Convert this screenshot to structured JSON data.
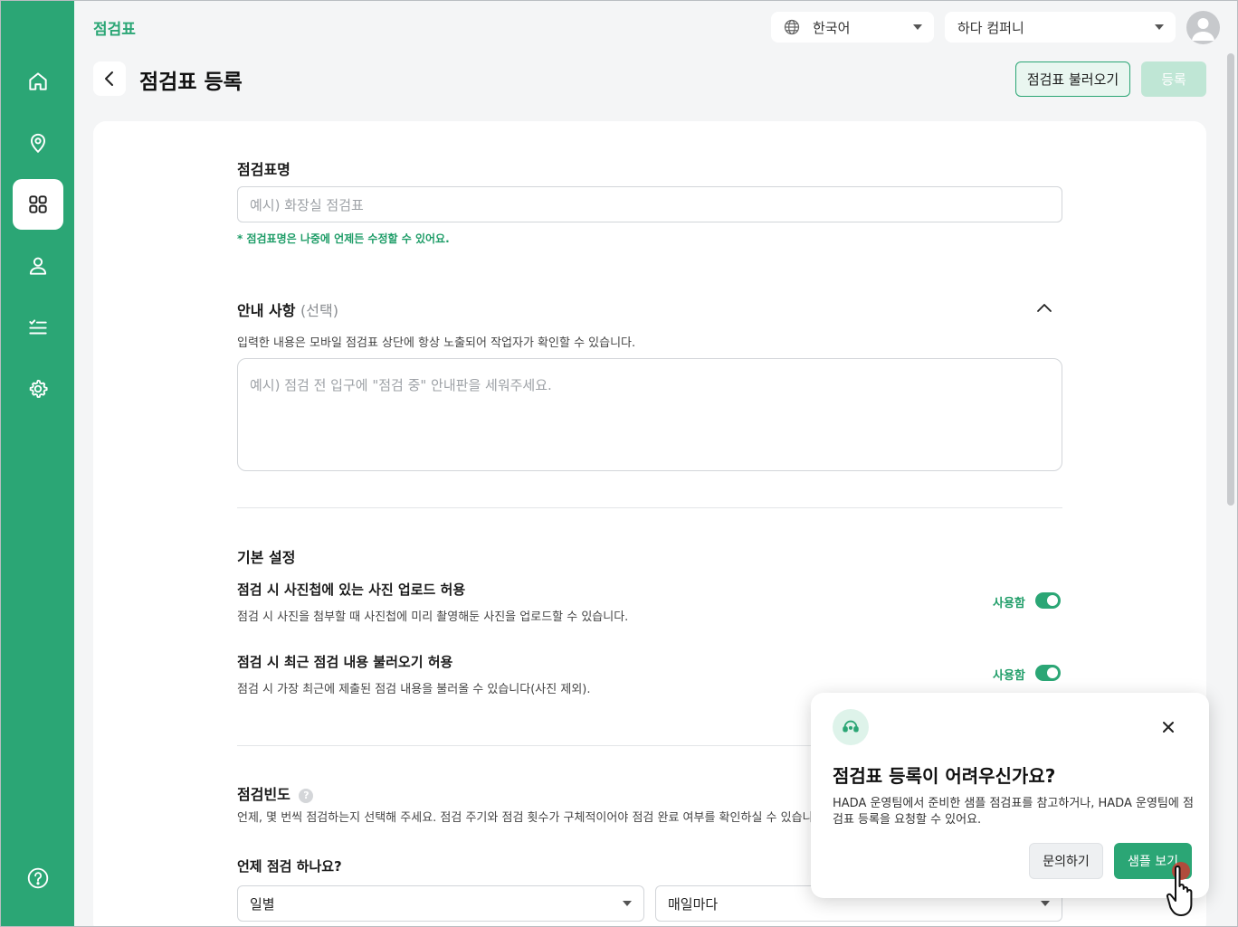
{
  "header": {
    "brand": "점검표",
    "language": "한국어",
    "company": "하다 컴퍼니"
  },
  "sidebar": {
    "items": [
      {
        "name": "home-icon"
      },
      {
        "name": "location-icon"
      },
      {
        "name": "grid-icon",
        "active": true
      },
      {
        "name": "user-icon"
      },
      {
        "name": "checklist-icon"
      },
      {
        "name": "gear-icon"
      }
    ],
    "help": "?"
  },
  "page": {
    "title": "점검표 등록",
    "load_button": "점검표 불러오기",
    "submit_button": "등록"
  },
  "form": {
    "name_label": "점검표명",
    "name_placeholder": "예시) 화장실 점검표",
    "name_note": "* 점검표명은 나중에 언제든 수정할 수 있어요.",
    "notice_label": "안내 사항",
    "notice_optional": "(선택)",
    "notice_help": "입력한 내용은 모바일 점검표 상단에 항상 노출되어 작업자가 확인할 수 있습니다.",
    "notice_placeholder": "예시) 점검 전 입구에 \"점검 중\" 안내판을 세워주세요.",
    "basic_settings": "기본 설정",
    "settings": [
      {
        "title": "점검 시 사진첩에 있는 사진 업로드 허용",
        "desc": "점검 시 사진을 첨부할 때 사진첩에 미리 촬영해둔 사진을 업로드할 수 있습니다.",
        "state": "사용함"
      },
      {
        "title": "점검 시 최근 점검 내용 불러오기 허용",
        "desc": "점검 시 가장 최근에 제출된 점검 내용을 불러올 수 있습니다(사진 제외).",
        "state": "사용함"
      }
    ],
    "frequency_label": "점검빈도",
    "frequency_help": "언제, 몇 번씩 점검하는지 선택해 주세요. 점검 주기와 점검 횟수가 구체적이어야 점검 완료 여부를 확인하실 수 있습니다.",
    "when_label": "언제 점검 하나요?",
    "period_value": "일별",
    "repeat_value": "매일마다"
  },
  "popup": {
    "title": "점검표 등록이 어려우신가요?",
    "text": "HADA 운영팀에서 준비한 샘플 점검표를 참고하거나, HADA 운영팀에 점검표 등록을 요청할 수 있어요.",
    "contact_button": "문의하기",
    "sample_button": "샘플 보기"
  },
  "colors": {
    "brand": "#2ba675",
    "note": "#1f9d68"
  }
}
